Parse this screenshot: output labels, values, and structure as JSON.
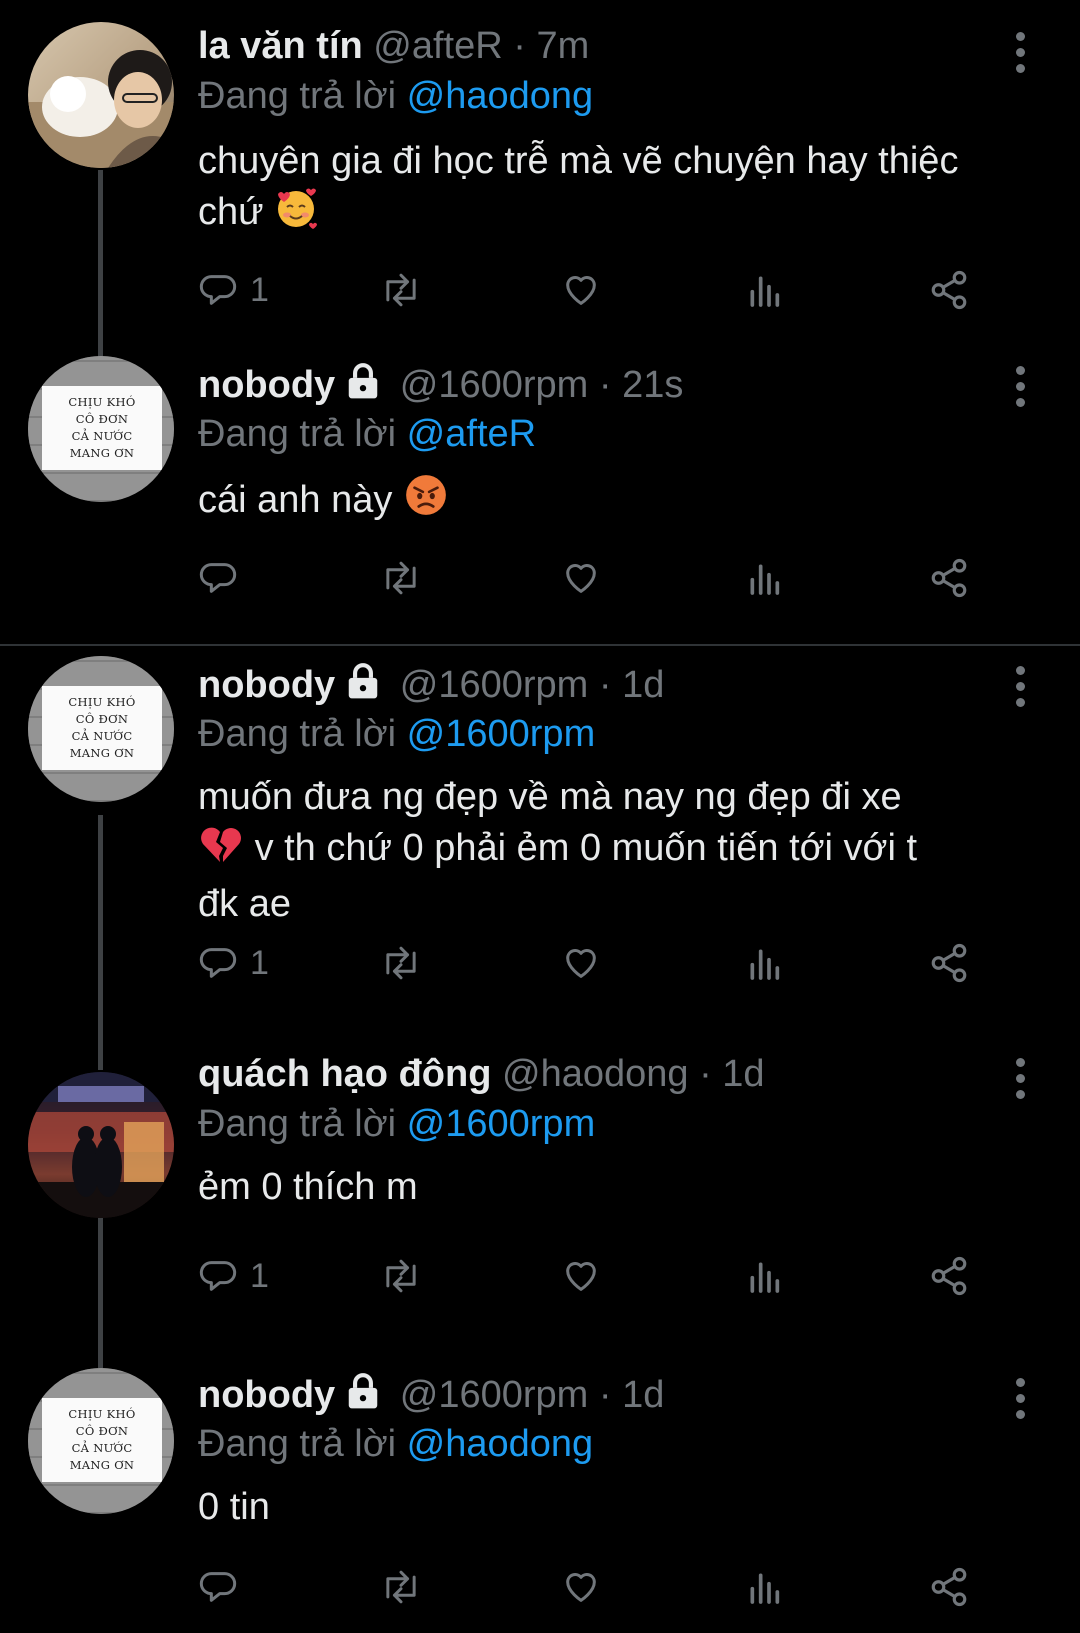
{
  "tweets": [
    {
      "name": "la văn tín",
      "handle": "@afteR",
      "time": "7m",
      "replying_prefix": "Đang trả lời",
      "replying_to": "@haodong",
      "text": "chuyên gia đi học trễ mà vẽ chuyện hay thiệc chứ",
      "emoji": "smiling-face-with-hearts",
      "reply_count": "1",
      "locked": false,
      "avatar": "photo"
    },
    {
      "name": "nobody",
      "handle": "@1600rpm",
      "time": "21s",
      "replying_prefix": "Đang trả lời",
      "replying_to": "@afteR",
      "text": "cái anh này",
      "emoji": "angry-face",
      "reply_count": "",
      "locked": true,
      "avatar": "sign"
    },
    {
      "name": "nobody",
      "handle": "@1600rpm",
      "time": "1d",
      "replying_prefix": "Đang trả lời",
      "replying_to": "@1600rpm",
      "text_line1": "muốn đưa ng đẹp về mà nay ng đẹp đi xe",
      "text_line2": "v th chứ 0 phải ẻm 0 muốn tiến tới với t",
      "text_line3": "đk ae",
      "emoji": "broken-heart",
      "reply_count": "1",
      "locked": true,
      "avatar": "sign"
    },
    {
      "name": "quách hạo đông",
      "handle": "@haodong",
      "time": "1d",
      "replying_prefix": "Đang trả lời",
      "replying_to": "@1600rpm",
      "text": "ẻm 0 thích m",
      "reply_count": "1",
      "locked": false,
      "avatar": "night"
    },
    {
      "name": "nobody",
      "handle": "@1600rpm",
      "time": "1d",
      "replying_prefix": "Đang trả lời",
      "replying_to": "@haodong",
      "text": "0 tin",
      "reply_count": "",
      "locked": true,
      "avatar": "sign"
    }
  ],
  "avatar_sign_text": [
    "CHỊU KHÓ",
    "CÔ ĐƠN",
    "CẢ NƯỚC",
    "MANG ƠN"
  ],
  "separator": "·",
  "colors": {
    "background": "#000000",
    "text": "#e7e9ea",
    "muted": "#71767b",
    "mention": "#1d9bf0",
    "thread_line": "#3e4144"
  }
}
